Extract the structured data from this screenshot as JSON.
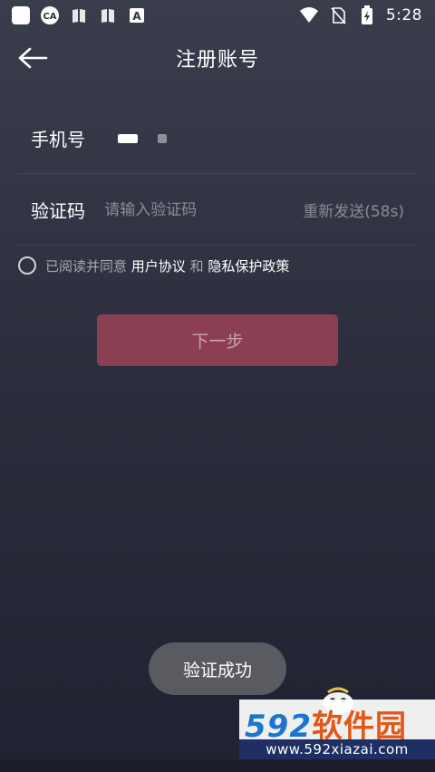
{
  "status_bar": {
    "time": "5:28",
    "left_icons": [
      "app-square-icon",
      "ca-icon",
      "book-icon",
      "book-icon",
      "a-icon"
    ],
    "right_icons": [
      "wifi-icon",
      "no-sim-icon",
      "battery-charging-icon"
    ]
  },
  "header": {
    "title": "注册账号",
    "back_icon": "back-arrow-icon"
  },
  "form": {
    "phone_label": "手机号",
    "code_label": "验证码",
    "code_placeholder": "请输入验证码",
    "resend_label": "重新发送(58s)"
  },
  "agreement": {
    "prefix": "已阅读并同意 ",
    "user_agreement": "用户协议",
    "and": " 和 ",
    "privacy_policy": "隐私保护政策",
    "checked": false
  },
  "next_button": {
    "label": "下一步"
  },
  "toast": {
    "message": "验证成功"
  },
  "watermark": {
    "number": "592",
    "brand": "软件园",
    "url": "www.592xiazai.com"
  },
  "colors": {
    "button_bg": "#8c3e52",
    "button_text": "#c7a6ae",
    "toast_bg": "#5a5b60",
    "placeholder": "#8a8d99",
    "watermark_blue": "#1a76d2",
    "watermark_orange": "#e25818",
    "watermark_band": "#1f2f63"
  }
}
